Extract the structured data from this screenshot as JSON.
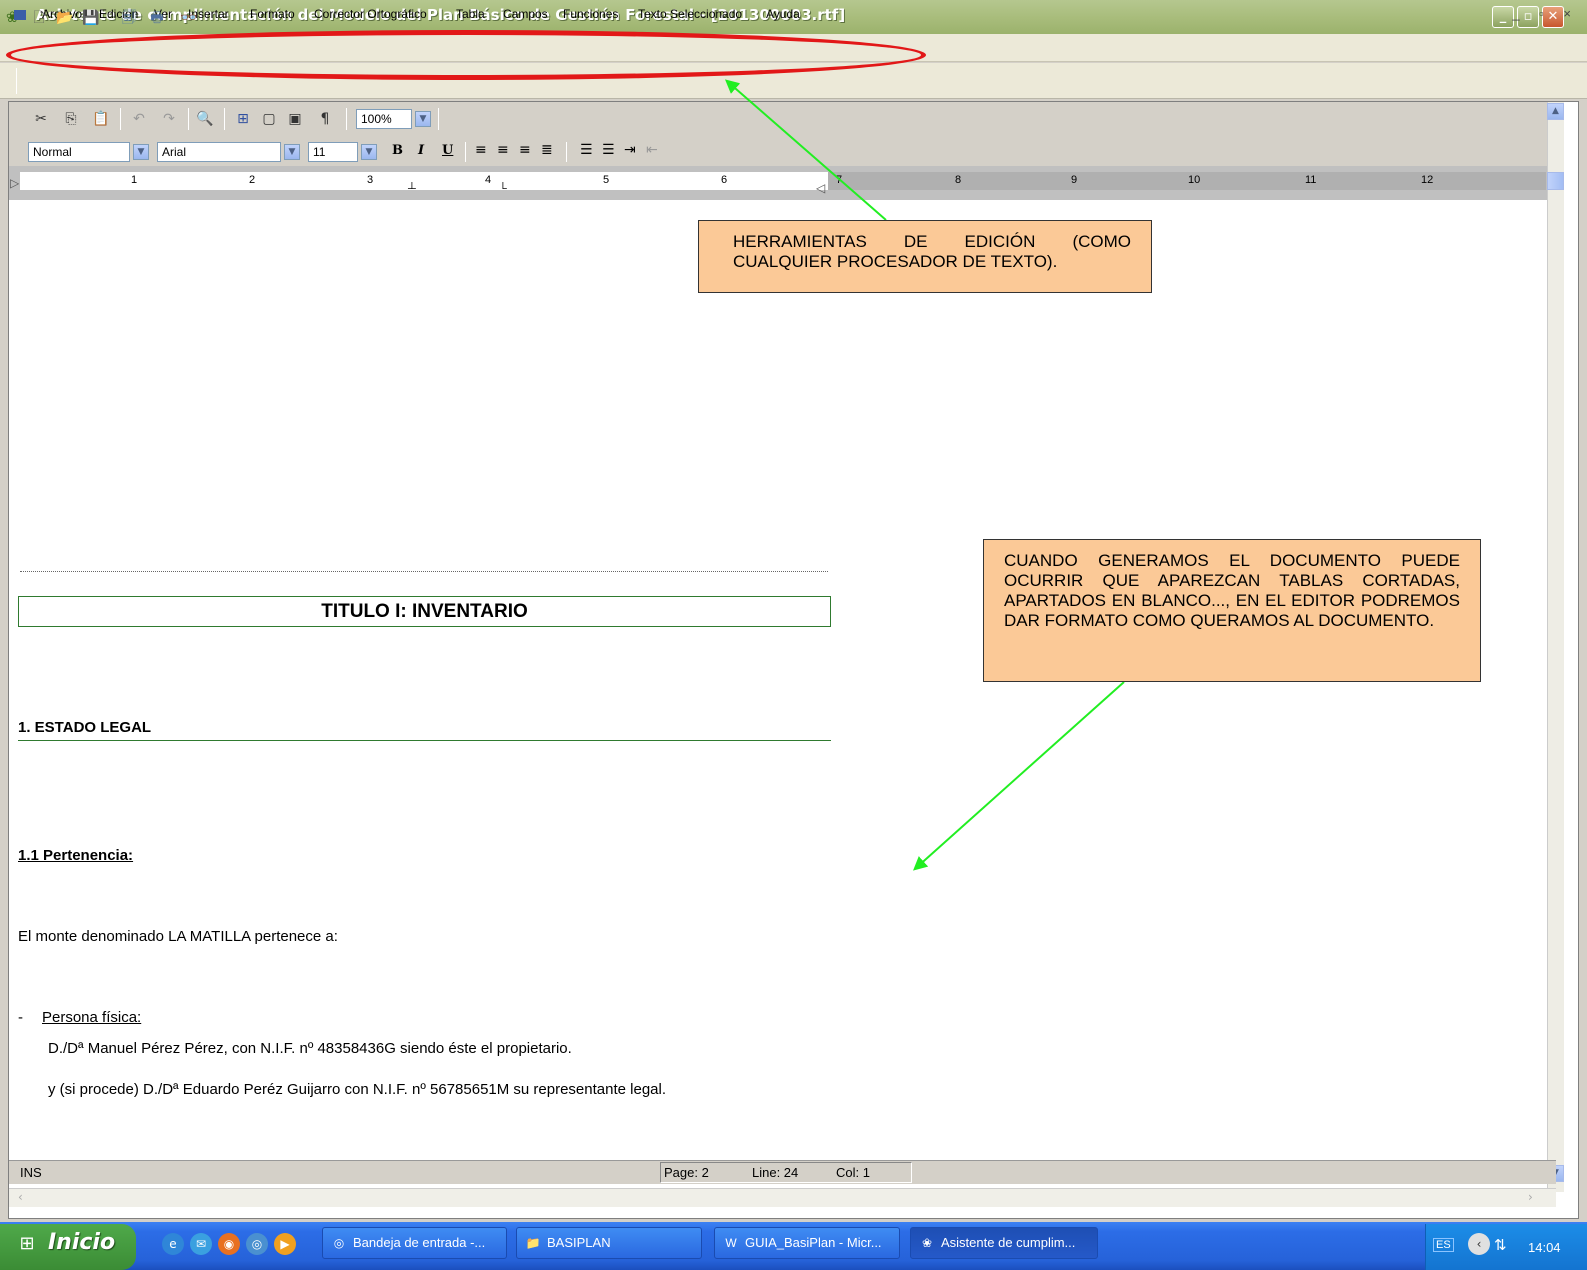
{
  "window": {
    "title": "Asistente de cumplimentación del Modelo del Plan Básico de Gestión Forestal - [201300003.rtf]",
    "controls": [
      "_",
      "▫",
      "✕"
    ]
  },
  "menu": {
    "items": [
      "Archivo",
      "Edicion",
      "Ver",
      "Insertar",
      "Formato",
      "Corrector Ortográfico",
      "Tabla",
      "Campos",
      "Funciones",
      "Texto Seleccionado",
      "Ayuda"
    ],
    "mdi_controls": "_ ▫ ×"
  },
  "editor_toolbar": {
    "zoom": "100%",
    "style": "Normal",
    "font": "Arial",
    "size": "11",
    "bold": "B",
    "italic": "I",
    "underline": "U",
    "pilcrow": "¶"
  },
  "ruler": {
    "numbers": [
      "1",
      "2",
      "3",
      "4",
      "5",
      "6",
      "7",
      "8",
      "9",
      "10",
      "11",
      "12"
    ]
  },
  "document": {
    "title": "TITULO I: INVENTARIO",
    "heading1": "1. ESTADO LEGAL",
    "heading2": "1.1 Pertenencia:",
    "para1": "El monte denominado LA MATILLA pertenece a:",
    "dash": "-",
    "persona": "Persona física:",
    "line1": "D./Dª Manuel Pérez Pérez, con N.I.F. nº 48358436G siendo éste el propietario.",
    "line2": "y (si procede) D./Dª Eduardo Peréz Guijarro con N.I.F. nº 56785651M su representante legal."
  },
  "status": {
    "mode": "INS",
    "page": "Page: 2",
    "line": "Line: 24",
    "col": "Col: 1"
  },
  "callouts": {
    "c1": "HERRAMIENTAS DE EDICIÓN (COMO CUALQUIER PROCESADOR DE TEXTO).",
    "c2": "CUANDO GENERAMOS EL DOCUMENTO PUEDE OCURRIR QUE APAREZCAN TABLAS CORTADAS, APARTADOS EN BLANCO..., EN EL EDITOR PODREMOS DAR FORMATO COMO QUERAMOS AL DOCUMENTO."
  },
  "taskbar": {
    "start": "Inicio",
    "tasks": [
      "Bandeja de entrada -...",
      "BASIPLAN",
      "GUIA_BasiPlan - Micr...",
      "Asistente de cumplim..."
    ],
    "lang": "ES",
    "clock": "14:04"
  },
  "colors": {
    "annotation_red": "#e21818",
    "arrow_green": "#22ee22",
    "callout_fill": "#fbc997"
  }
}
